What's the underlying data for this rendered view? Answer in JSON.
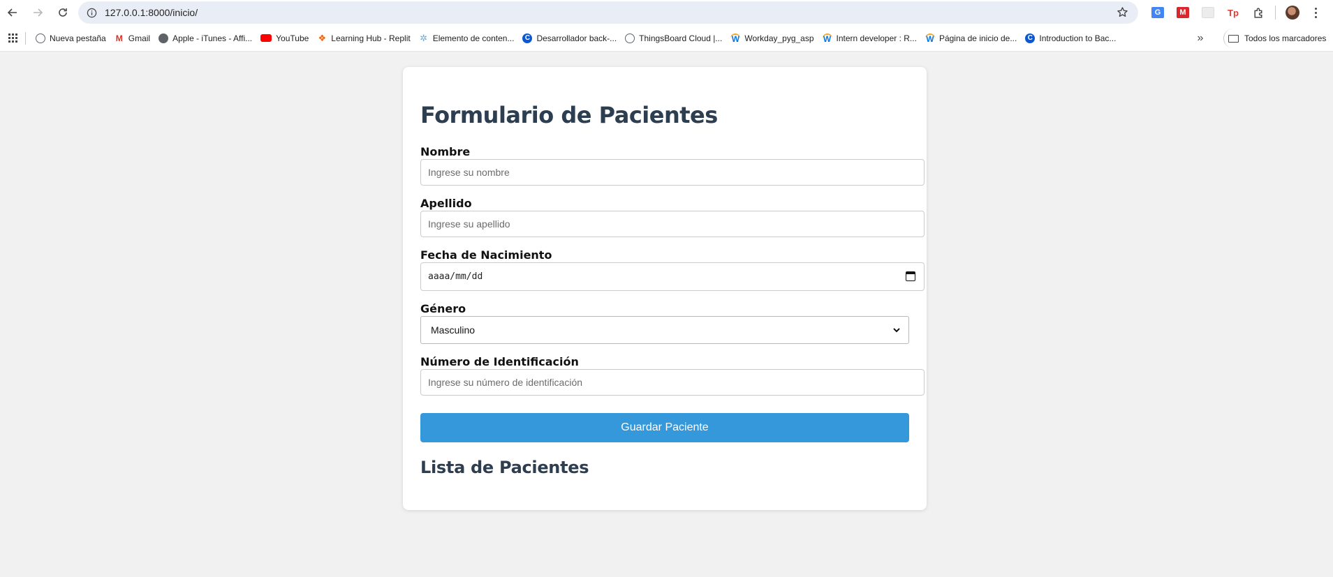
{
  "browser": {
    "url": "127.0.0.1:8000/inicio/",
    "bookmarks": [
      {
        "label": "Nueva pestaña",
        "icon": "globe-icon"
      },
      {
        "label": "Gmail",
        "icon": "gmail-icon"
      },
      {
        "label": "Apple - iTunes - Affi...",
        "icon": "apple-icon"
      },
      {
        "label": "YouTube",
        "icon": "youtube-icon"
      },
      {
        "label": "Learning Hub - Replit",
        "icon": "replit-icon"
      },
      {
        "label": "Elemento de conten...",
        "icon": "gear-icon"
      },
      {
        "label": "Desarrollador back-...",
        "icon": "c-logo-icon"
      },
      {
        "label": "ThingsBoard Cloud |...",
        "icon": "globe-icon"
      },
      {
        "label": "Workday_pyg_asp",
        "icon": "workday-icon"
      },
      {
        "label": "Intern developer : R...",
        "icon": "workday-icon"
      },
      {
        "label": "Página de inicio de...",
        "icon": "workday-icon"
      },
      {
        "label": "Introduction to Bac...",
        "icon": "c-logo-icon"
      }
    ],
    "all_bookmarks_label": "Todos los marcadores",
    "extensions": [
      {
        "name": "translate-extension-icon",
        "color": "#4285f4",
        "text": "G"
      },
      {
        "name": "mega-extension-icon",
        "color": "#d9272e",
        "text": "M"
      },
      {
        "name": "blank-extension-icon",
        "color": "#e8e8e8",
        "text": ""
      },
      {
        "name": "tp-extension-icon",
        "color": "#ffffff",
        "text": "Tp"
      }
    ]
  },
  "form": {
    "title": "Formulario de Pacientes",
    "nombre": {
      "label": "Nombre",
      "placeholder": "Ingrese su nombre"
    },
    "apellido": {
      "label": "Apellido",
      "placeholder": "Ingrese su apellido"
    },
    "fecha": {
      "label": "Fecha de Nacimiento",
      "placeholder": "aaaa/mm/dd"
    },
    "genero": {
      "label": "Género",
      "selected": "Masculino"
    },
    "identificacion": {
      "label": "Número de Identificación",
      "placeholder": "Ingrese su número de identificación"
    },
    "save_label": "Guardar Paciente"
  },
  "list": {
    "title": "Lista de Pacientes"
  },
  "colors": {
    "accent": "#3498db",
    "heading": "#2c3e50",
    "page_bg": "#f1f1f1"
  }
}
